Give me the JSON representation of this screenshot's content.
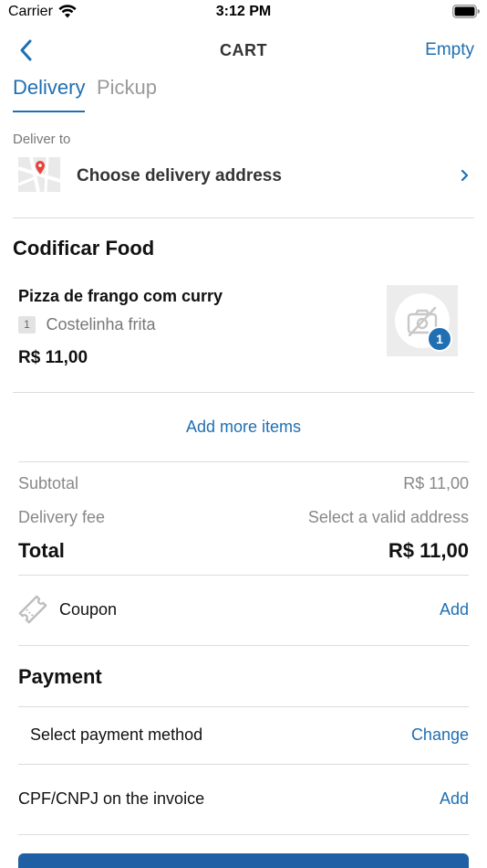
{
  "status_bar": {
    "carrier": "Carrier",
    "time": "3:12 PM"
  },
  "nav": {
    "title": "CART",
    "empty_label": "Empty"
  },
  "tabs": [
    {
      "label": "Delivery",
      "active": true
    },
    {
      "label": "Pickup",
      "active": false
    }
  ],
  "delivery": {
    "label": "Deliver to",
    "address_placeholder": "Choose delivery address"
  },
  "store": {
    "name": "Codificar Food"
  },
  "cart_item": {
    "name": "Pizza de frango com curry",
    "option_quantity": "1",
    "option_name": "Costelinha frita",
    "price": "R$ 11,00",
    "count": "1"
  },
  "add_more_label": "Add more items",
  "summary": {
    "subtotal_label": "Subtotal",
    "subtotal_value": "R$ 11,00",
    "delivery_fee_label": "Delivery fee",
    "delivery_fee_value": "Select a valid address",
    "total_label": "Total",
    "total_value": "R$ 11,00"
  },
  "coupon": {
    "label": "Coupon",
    "action": "Add"
  },
  "payment": {
    "title": "Payment",
    "method_label": "Select payment method",
    "method_action": "Change"
  },
  "invoice": {
    "label": "CPF/CNPJ on the invoice",
    "action": "Add"
  },
  "colors": {
    "accent": "#1f6fb2",
    "button": "#1f5fa3",
    "muted_text": "#888888",
    "divider": "#dcdcdc"
  }
}
